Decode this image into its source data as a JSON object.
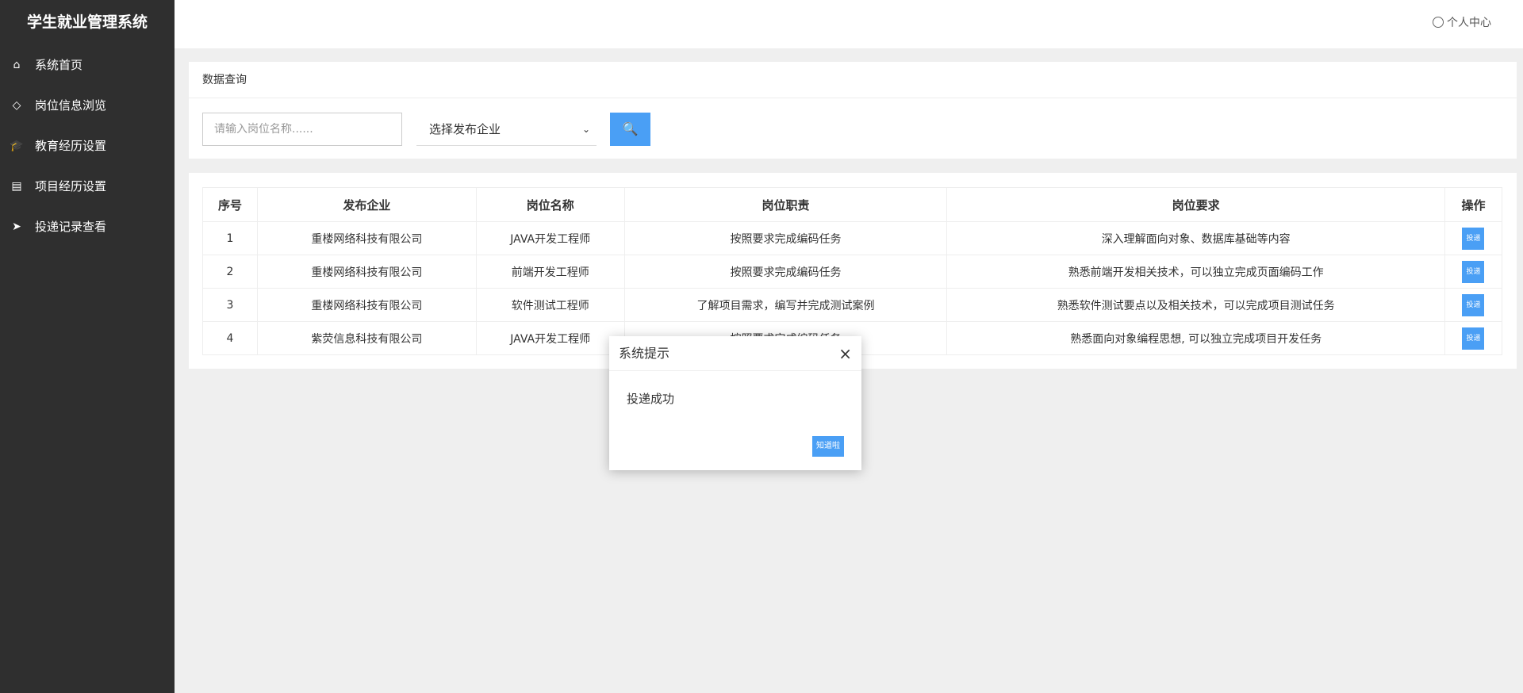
{
  "app_title": "学生就业管理系统",
  "sidebar": {
    "items": [
      {
        "icon": "home-icon",
        "glyph": "⌂",
        "label": "系统首页"
      },
      {
        "icon": "diamond-icon",
        "glyph": "◇",
        "label": "岗位信息浏览"
      },
      {
        "icon": "graduation-cap-icon",
        "glyph": "🎓",
        "label": "教育经历设置"
      },
      {
        "icon": "newspaper-icon",
        "glyph": "▤",
        "label": "项目经历设置"
      },
      {
        "icon": "paper-plane-icon",
        "glyph": "➤",
        "label": "投递记录查看"
      }
    ]
  },
  "header": {
    "user_label": "个人中心"
  },
  "query": {
    "title": "数据查询",
    "input_placeholder": "请输入岗位名称......",
    "select_value": "选择发布企业",
    "search_icon": "🔍"
  },
  "table": {
    "headers": [
      "序号",
      "发布企业",
      "岗位名称",
      "岗位职责",
      "岗位要求",
      "操作"
    ],
    "rows": [
      [
        "1",
        "重楼网络科技有限公司",
        "JAVA开发工程师",
        "按照要求完成编码任务",
        "深入理解面向对象、数据库基础等内容",
        "投递"
      ],
      [
        "2",
        "重楼网络科技有限公司",
        "前端开发工程师",
        "按照要求完成编码任务",
        "熟悉前端开发相关技术，可以独立完成页面编码工作",
        "投递"
      ],
      [
        "3",
        "重楼网络科技有限公司",
        "软件测试工程师",
        "了解项目需求，编写并完成测试案例",
        "熟悉软件测试要点以及相关技术，可以完成项目测试任务",
        "投递"
      ],
      [
        "4",
        "紫荧信息科技有限公司",
        "JAVA开发工程师",
        "按照要求完成编码任务",
        "熟悉面向对象编程思想, 可以独立完成项目开发任务",
        "投递"
      ]
    ]
  },
  "dialog": {
    "title": "系统提示",
    "message": "投递成功",
    "button": "知道啦",
    "close": "×"
  },
  "colors": {
    "sidebar": "#2f2f2f",
    "accent": "#4a9ff5"
  }
}
